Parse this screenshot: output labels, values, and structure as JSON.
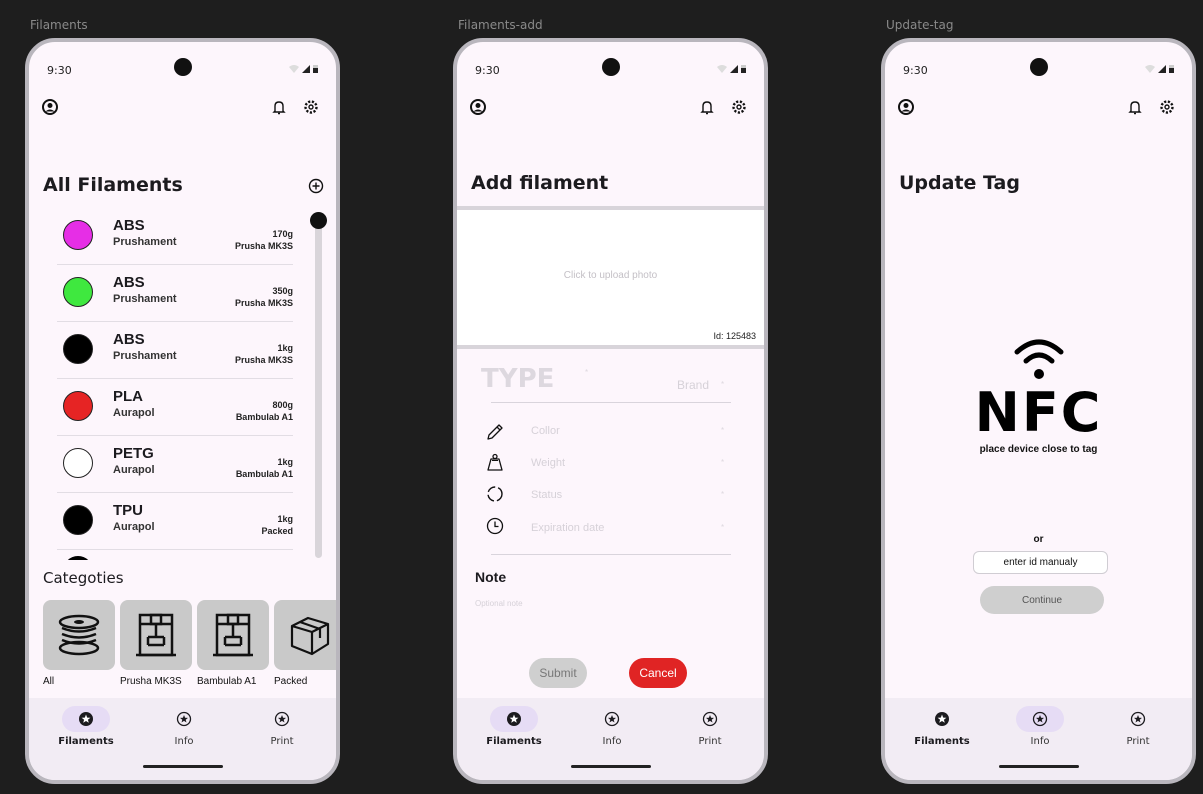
{
  "frames": [
    {
      "label": "Filaments"
    },
    {
      "label": "Filaments-add"
    },
    {
      "label": "Update-tag"
    }
  ],
  "status": {
    "time": "9:30"
  },
  "nav": {
    "filaments": "Filaments",
    "info": "Info",
    "print": "Print"
  },
  "filaments_screen": {
    "title": "All Filaments",
    "items": [
      {
        "type": "ABS",
        "brand": "Prushament",
        "weight": "170g",
        "printer": "Prusha MK3S",
        "color": "#e62ee6"
      },
      {
        "type": "ABS",
        "brand": "Prushament",
        "weight": "350g",
        "printer": "Prusha MK3S",
        "color": "#3fe83f"
      },
      {
        "type": "ABS",
        "brand": "Prushament",
        "weight": "1kg",
        "printer": "Prusha MK3S",
        "color": "#000000"
      },
      {
        "type": "PLA",
        "brand": "Aurapol",
        "weight": "800g",
        "printer": "Bambulab A1",
        "color": "#e62424"
      },
      {
        "type": "PETG",
        "brand": "Aurapol",
        "weight": "1kg",
        "printer": "Bambulab A1",
        "color": "#ffffff"
      },
      {
        "type": "TPU",
        "brand": "Aurapol",
        "weight": "1kg",
        "printer": "Packed",
        "color": "#000000"
      }
    ],
    "categories_title": "Categoties",
    "categories": [
      {
        "label": "All",
        "icon": "spool-icon"
      },
      {
        "label": "Prusha MK3S",
        "icon": "printer-icon"
      },
      {
        "label": "Bambulab A1",
        "icon": "printer-icon"
      },
      {
        "label": "Packed",
        "icon": "box-icon"
      }
    ]
  },
  "add_screen": {
    "title": "Add filament",
    "upload_hint": "Click to upload photo",
    "id_label": "Id: 125483",
    "type_placeholder": "TYPE",
    "brand_placeholder": "Brand",
    "required_mark": "*",
    "fields": [
      {
        "placeholder": "Collor",
        "icon": "eyedropper-icon"
      },
      {
        "placeholder": "Weight",
        "icon": "weight-icon"
      },
      {
        "placeholder": "Status",
        "icon": "status-icon"
      },
      {
        "placeholder": "Expiration date",
        "icon": "clock-icon"
      }
    ],
    "note_title": "Note",
    "note_placeholder": "Optional note",
    "submit_label": "Submit",
    "cancel_label": "Cancel",
    "colors": {
      "cancel": "#e02424",
      "submit": "#cfcfcf"
    }
  },
  "tag_screen": {
    "title": "Update Tag",
    "nfc_label": "NFC",
    "hint": "place device close to tag",
    "or_label": "or",
    "input_placeholder": "enter id manualy",
    "continue_label": "Continue"
  }
}
